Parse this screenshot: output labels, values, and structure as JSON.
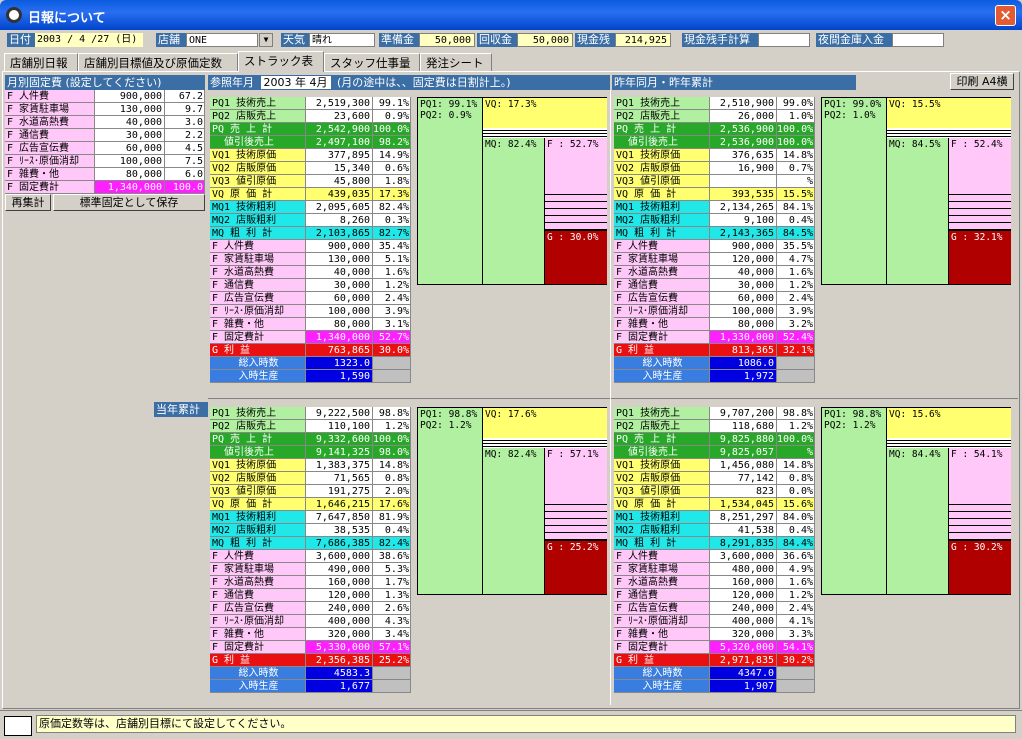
{
  "window": {
    "title": "日報について",
    "close": "×"
  },
  "header": {
    "date_label": "日付",
    "date_value": "2003 / 4 /27 (日)",
    "store_label": "店舗",
    "store_value": "ONE",
    "weather_label": "天気",
    "weather_value": "晴れ",
    "reserve_label": "準備金",
    "reserve_value": "50,000",
    "collect_label": "回収金",
    "collect_value": "50,000",
    "cash_label": "現金残",
    "cash_value": "214,925",
    "cashcalc_label": "現金残手計算",
    "cashcalc_value": "",
    "night_label": "夜間金庫入金",
    "night_value": ""
  },
  "tabs": [
    "店舗別日報",
    "店舗別目標値及び原価定数",
    "ストラック表",
    "スタッフ仕事量",
    "発注シート"
  ],
  "active_tab": 2,
  "fixed": {
    "title": "月別固定費 (設定してください)",
    "rows": [
      [
        "F 人件費",
        "900,000",
        "67.2"
      ],
      [
        "F 家賃駐車場",
        "130,000",
        "9.7"
      ],
      [
        "F 水道高熱費",
        "40,000",
        "3.0"
      ],
      [
        "F 通信費",
        "30,000",
        "2.2"
      ],
      [
        "F 広告宣伝費",
        "60,000",
        "4.5"
      ],
      [
        "F ﾘｰｽ･原価消却",
        "100,000",
        "7.5"
      ],
      [
        "F 雑費・他",
        "80,000",
        "6.0"
      ],
      [
        "F 固定費計",
        "1,340,000",
        "100.0"
      ]
    ],
    "recalc_btn": "再集計",
    "save_btn": "標準固定として保存"
  },
  "sections": {
    "ref_label": "参照年月",
    "ref_value": "2003 年 4月",
    "ref_note": "(月の途中は、、固定費は日割計上。)",
    "prev_label": "昨年同月・昨年累計",
    "print_btn": "印刷 A4横",
    "cum_label": "当年累計"
  },
  "labels": [
    "PQ1 技術売上",
    "PQ2 店販売上",
    "PQ 売 上 計",
    "値引後売上",
    "VQ1 技術原価",
    "VQ2 店販原価",
    "VQ3 値引原価",
    "VQ 原 価 計",
    "MQ1 技術粗利",
    "MQ2 店販粗利",
    "MQ 粗 利 計",
    "F 人件費",
    "F 家賃駐車場",
    "F 水道高熱費",
    "F 通信費",
    "F 広告宣伝費",
    "F ﾘｰｽ･原価消却",
    "F 雑費・他",
    "F 固定費計",
    "G 利 益",
    "総入時数",
    "入時生産"
  ],
  "colors": {
    "pq": "#b0f0a0",
    "pqsum": "#28a828",
    "vq": "#ffff70",
    "mq": "#20e8e8",
    "f": "#ffc8f8",
    "fsum": "#ff20ff",
    "g": "#e81010",
    "hours": "#0000e0",
    "header": "#3a6ea5"
  },
  "tables": [
    {
      "vals": [
        [
          "2,519,300",
          "99.1%"
        ],
        [
          "23,600",
          "0.9%"
        ],
        [
          "2,542,900",
          "100.0%"
        ],
        [
          "2,497,100",
          "98.2%"
        ],
        [
          "377,895",
          "14.9%"
        ],
        [
          "15,340",
          "0.6%"
        ],
        [
          "45,800",
          "1.8%"
        ],
        [
          "439,035",
          "17.3%"
        ],
        [
          "2,095,605",
          "82.4%"
        ],
        [
          "8,260",
          "0.3%"
        ],
        [
          "2,103,865",
          "82.7%"
        ],
        [
          "900,000",
          "35.4%"
        ],
        [
          "130,000",
          "5.1%"
        ],
        [
          "40,000",
          "1.6%"
        ],
        [
          "30,000",
          "1.2%"
        ],
        [
          "60,000",
          "2.4%"
        ],
        [
          "100,000",
          "3.9%"
        ],
        [
          "80,000",
          "3.1%"
        ],
        [
          "1,340,000",
          "52.7%"
        ],
        [
          "763,865",
          "30.0%"
        ],
        [
          "1323.0",
          ""
        ],
        [
          "1,590",
          ""
        ]
      ],
      "box": {
        "pq1": "PQ1: 99.1%",
        "pq2": "PQ2: 0.9%",
        "vq": "VQ: 17.3%",
        "mq": "MQ: 82.4%",
        "f": "F : 52.7%",
        "g": "G : 30.0%"
      }
    },
    {
      "vals": [
        [
          "2,510,900",
          "99.0%"
        ],
        [
          "26,000",
          "1.0%"
        ],
        [
          "2,536,900",
          "100.0%"
        ],
        [
          "2,536,900",
          "100.0%"
        ],
        [
          "376,635",
          "14.8%"
        ],
        [
          "16,900",
          "0.7%"
        ],
        [
          "",
          "%"
        ],
        [
          "393,535",
          "15.5%"
        ],
        [
          "2,134,265",
          "84.1%"
        ],
        [
          "9,100",
          "0.4%"
        ],
        [
          "2,143,365",
          "84.5%"
        ],
        [
          "900,000",
          "35.5%"
        ],
        [
          "120,000",
          "4.7%"
        ],
        [
          "40,000",
          "1.6%"
        ],
        [
          "30,000",
          "1.2%"
        ],
        [
          "60,000",
          "2.4%"
        ],
        [
          "100,000",
          "3.9%"
        ],
        [
          "80,000",
          "3.2%"
        ],
        [
          "1,330,000",
          "52.4%"
        ],
        [
          "813,365",
          "32.1%"
        ],
        [
          "1086.0",
          ""
        ],
        [
          "1,972",
          ""
        ]
      ],
      "box": {
        "pq1": "PQ1: 99.0%",
        "pq2": "PQ2: 1.0%",
        "vq": "VQ: 15.5%",
        "mq": "MQ: 84.5%",
        "f": "F : 52.4%",
        "g": "G : 32.1%"
      }
    },
    {
      "vals": [
        [
          "9,222,500",
          "98.8%"
        ],
        [
          "110,100",
          "1.2%"
        ],
        [
          "9,332,600",
          "100.0%"
        ],
        [
          "9,141,325",
          "98.0%"
        ],
        [
          "1,383,375",
          "14.8%"
        ],
        [
          "71,565",
          "0.8%"
        ],
        [
          "191,275",
          "2.0%"
        ],
        [
          "1,646,215",
          "17.6%"
        ],
        [
          "7,647,850",
          "81.9%"
        ],
        [
          "38,535",
          "0.4%"
        ],
        [
          "7,686,385",
          "82.4%"
        ],
        [
          "3,600,000",
          "38.6%"
        ],
        [
          "490,000",
          "5.3%"
        ],
        [
          "160,000",
          "1.7%"
        ],
        [
          "120,000",
          "1.3%"
        ],
        [
          "240,000",
          "2.6%"
        ],
        [
          "400,000",
          "4.3%"
        ],
        [
          "320,000",
          "3.4%"
        ],
        [
          "5,330,000",
          "57.1%"
        ],
        [
          "2,356,385",
          "25.2%"
        ],
        [
          "4583.3",
          ""
        ],
        [
          "1,677",
          ""
        ]
      ],
      "box": {
        "pq1": "PQ1: 98.8%",
        "pq2": "PQ2: 1.2%",
        "vq": "VQ: 17.6%",
        "mq": "MQ: 82.4%",
        "f": "F : 57.1%",
        "g": "G : 25.2%"
      }
    },
    {
      "vals": [
        [
          "9,707,200",
          "98.8%"
        ],
        [
          "118,680",
          "1.2%"
        ],
        [
          "9,825,880",
          "100.0%"
        ],
        [
          "9,825,057",
          "%"
        ],
        [
          "1,456,080",
          "14.8%"
        ],
        [
          "77,142",
          "0.8%"
        ],
        [
          "823",
          "0.0%"
        ],
        [
          "1,534,045",
          "15.6%"
        ],
        [
          "8,251,297",
          "84.0%"
        ],
        [
          "41,538",
          "0.4%"
        ],
        [
          "8,291,835",
          "84.4%"
        ],
        [
          "3,600,000",
          "36.6%"
        ],
        [
          "480,000",
          "4.9%"
        ],
        [
          "160,000",
          "1.6%"
        ],
        [
          "120,000",
          "1.2%"
        ],
        [
          "240,000",
          "2.4%"
        ],
        [
          "400,000",
          "4.1%"
        ],
        [
          "320,000",
          "3.3%"
        ],
        [
          "5,320,000",
          "54.1%"
        ],
        [
          "2,971,835",
          "30.2%"
        ],
        [
          "4347.0",
          ""
        ],
        [
          "1,907",
          ""
        ]
      ],
      "box": {
        "pq1": "PQ1: 98.8%",
        "pq2": "PQ2: 1.2%",
        "vq": "VQ: 15.6%",
        "mq": "MQ: 84.4%",
        "f": "F : 54.1%",
        "g": "G : 30.2%"
      }
    }
  ],
  "status": "原価定数等は、店舗別目標にて設定してください。"
}
